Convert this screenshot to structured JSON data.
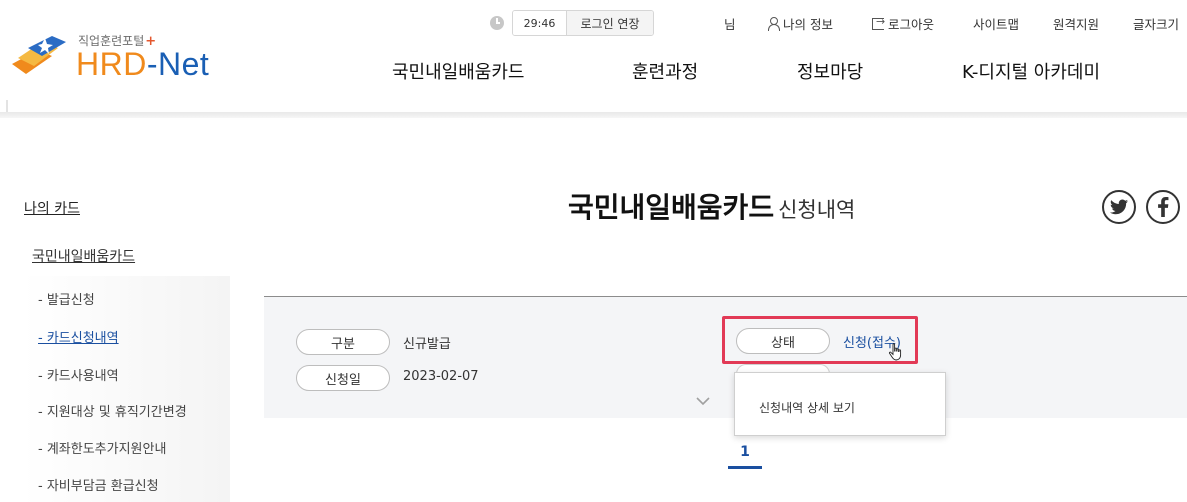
{
  "logo": {
    "subtitle": "직업훈련포털",
    "plus": "+",
    "brand_hrd": "HRD",
    "brand_dash": "-",
    "brand_net": "Net"
  },
  "util": {
    "timer": "29:46",
    "extend_label": "로그인 연장",
    "user_suffix": "님",
    "my_info": "나의 정보",
    "logout": "로그아웃",
    "sitemap": "사이트맵",
    "remote_support": "원격지원",
    "font_size": "글자크기"
  },
  "gnb": {
    "items": [
      "국민내일배움카드",
      "훈련과정",
      "정보마당",
      "K-디지털 아카데미"
    ]
  },
  "sidebar": {
    "title": "나의 카드",
    "sub_title": "국민내일배움카드",
    "items": [
      {
        "label": "- 발급신청",
        "active": false
      },
      {
        "label": "- 카드신청내역",
        "active": true
      },
      {
        "label": "- 카드사용내역",
        "active": false
      },
      {
        "label": "- 지원대상 및 휴직기간변경",
        "active": false
      },
      {
        "label": "- 계좌한도추가지원안내",
        "active": false
      },
      {
        "label": "- 자비부담금 환급신청",
        "active": false
      }
    ]
  },
  "page": {
    "title": "국민내일배움카드",
    "subtitle": "신청내역",
    "sns": {
      "twitter_icon": "twitter-icon",
      "facebook_icon": "facebook-icon"
    }
  },
  "record": {
    "type_label": "구분",
    "type_value": "신규발급",
    "date_label": "신청일",
    "date_value": "2023-02-07",
    "status_label": "상태",
    "status_value": "신청(접수)"
  },
  "tooltip": {
    "text": "신청내역 상세 보기"
  },
  "pagination": {
    "current": "1"
  },
  "colors": {
    "accent": "#1a4fa0",
    "highlight": "#e23a56",
    "brand_orange": "#f08a1c"
  }
}
